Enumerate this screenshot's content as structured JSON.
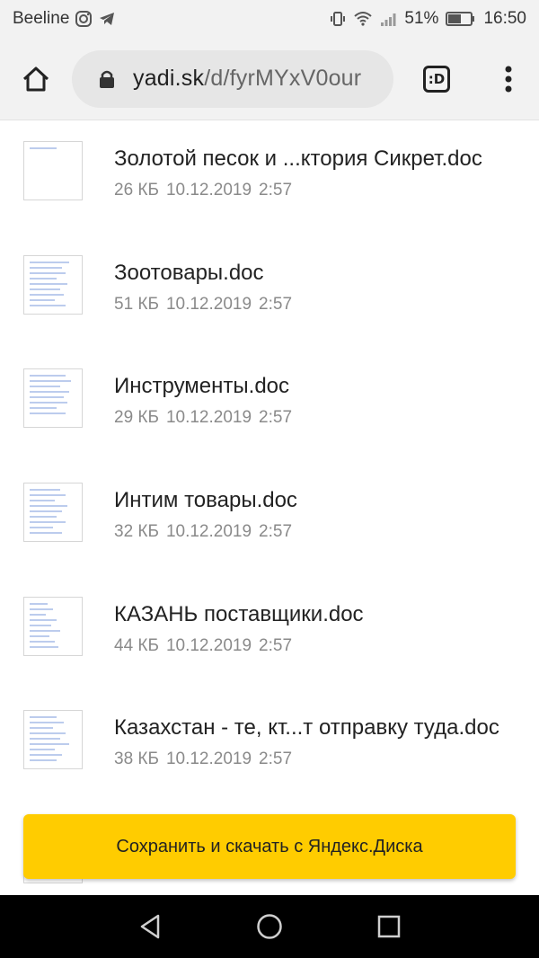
{
  "status_bar": {
    "carrier": "Beeline",
    "battery": "51%",
    "time": "16:50",
    "icons": [
      "instagram-icon",
      "telegram-icon",
      "vibrate-icon",
      "wifi-icon",
      "signal-icon",
      "battery-icon"
    ]
  },
  "browser": {
    "url_host": "yadi.sk",
    "url_path": "/d/fyrMYxV0our",
    "tabs_label": ":D",
    "icons": [
      "home-icon",
      "lock-icon",
      "tabs-icon",
      "more-vert-icon"
    ]
  },
  "files": [
    {
      "name": "Золотой песок и ...ктория Сикрет.doc",
      "size": "26 КБ",
      "date": "10.12.2019",
      "time": "2:57"
    },
    {
      "name": "Зоотовары.doc",
      "size": "51 КБ",
      "date": "10.12.2019",
      "time": "2:57"
    },
    {
      "name": "Инструменты.doc",
      "size": "29 КБ",
      "date": "10.12.2019",
      "time": "2:57"
    },
    {
      "name": "Интим товары.doc",
      "size": "32 КБ",
      "date": "10.12.2019",
      "time": "2:57"
    },
    {
      "name": "КАЗАНЬ поставщики.doc",
      "size": "44 КБ",
      "date": "10.12.2019",
      "time": "2:57"
    },
    {
      "name": "Казахстан - те, кт...т отправку туда.doc",
      "size": "38 КБ",
      "date": "10.12.2019",
      "time": "2:57"
    }
  ],
  "save_button": {
    "label": "Сохранить и скачать с Яндекс.Диска",
    "color": "#ffcc00"
  },
  "nav_bar": {
    "icons": [
      "back-icon",
      "home-circle-icon",
      "recents-icon"
    ]
  }
}
